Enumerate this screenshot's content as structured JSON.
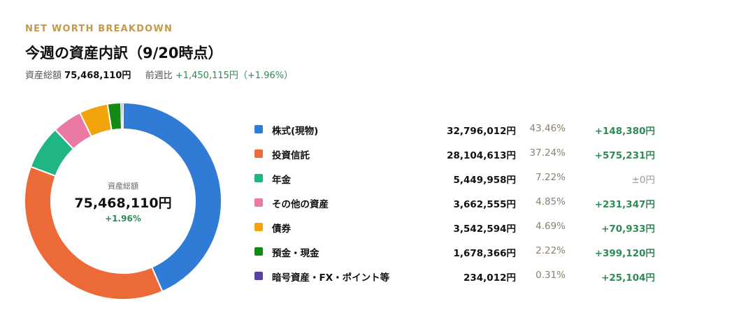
{
  "header": {
    "eyebrow": "NET WORTH BREAKDOWN",
    "title": "今週の資産内訳（9/20時点）",
    "total_label": "資産総額",
    "total_value": "75,468,110円",
    "compare_label": "前週比",
    "compare_value": "+1,450,115円（+1.96%）"
  },
  "donut_center": {
    "label": "資産総額",
    "value": "75,468,110円",
    "change": "+1.96%"
  },
  "colors": {
    "positive": "#2e8b57",
    "neutral": "#9a9a9a",
    "accent": "#c49a48"
  },
  "chart_data": {
    "type": "pie",
    "categories": [
      "株式(現物)",
      "投資信託",
      "年金",
      "その他の資産",
      "債券",
      "預金・現金",
      "暗号資産・FX・ポイント等"
    ],
    "values": [
      32796012,
      28104613,
      5449958,
      3662555,
      3542594,
      1678366,
      234012
    ],
    "value_labels": [
      "32,796,012円",
      "28,104,613円",
      "5,449,958円",
      "3,662,555円",
      "3,542,594円",
      "1,678,366円",
      "234,012円"
    ],
    "percent_labels": [
      "43.46%",
      "37.24%",
      "7.22%",
      "4.85%",
      "4.69%",
      "2.22%",
      "0.31%"
    ],
    "change_labels": [
      "+148,380円",
      "+575,231円",
      "±0円",
      "+231,347円",
      "+70,933円",
      "+399,120円",
      "+25,104円"
    ],
    "colors": [
      "#2f7bd6",
      "#ec6a37",
      "#1fb584",
      "#ea7aa4",
      "#f0a30a",
      "#138a13",
      "#5a3fa8"
    ],
    "legend_position": "right",
    "donut": true
  }
}
